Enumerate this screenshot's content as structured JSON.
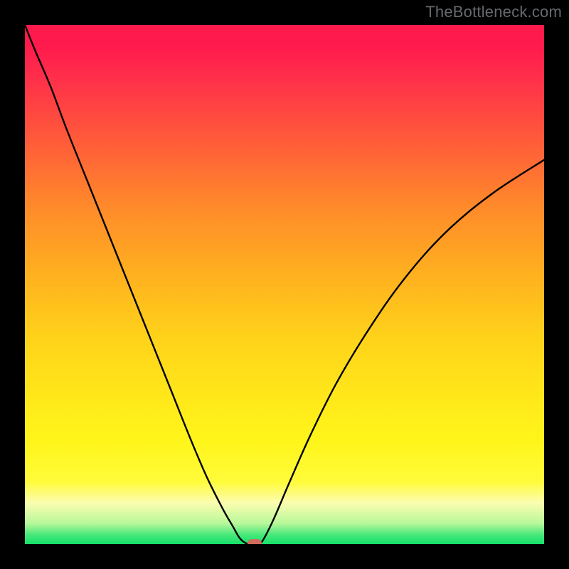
{
  "watermark": "TheBottleneck.com",
  "chart_data": {
    "type": "line",
    "title": "",
    "xlabel": "",
    "ylabel": "",
    "xlim": [
      0,
      100
    ],
    "ylim": [
      0,
      100
    ],
    "grid": false,
    "legend": false,
    "series": [
      {
        "name": "bottleneck-curve",
        "x": [
          0,
          2,
          5,
          8,
          12,
          16,
          20,
          24,
          28,
          32,
          35,
          38,
          40,
          41.5,
          43,
          44,
          45,
          46,
          48,
          51,
          55,
          60,
          66,
          73,
          81,
          90,
          100
        ],
        "y": [
          100,
          95,
          88,
          80,
          70,
          60,
          50,
          40,
          30,
          20,
          13,
          7,
          3.5,
          1,
          0,
          0,
          0,
          1,
          5,
          12,
          21,
          31,
          41,
          51,
          60,
          67.5,
          74
        ]
      }
    ],
    "marker": {
      "x": 44.3,
      "y": 0.2
    },
    "colors": {
      "curve": "#000000",
      "frame": "#000000",
      "marker": "#d06a5c",
      "gradient_top": "#ff1a4d",
      "gradient_mid": "#ffd21a",
      "gradient_bottom": "#15e06a"
    }
  }
}
